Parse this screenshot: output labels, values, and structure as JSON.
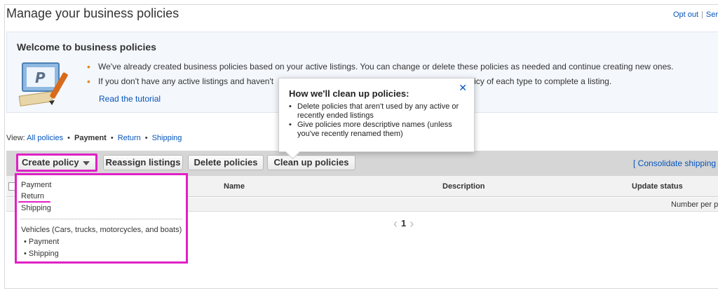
{
  "header": {
    "page_title": "Manage your business policies",
    "opt_out": "Opt out",
    "separator": "|",
    "truncated_link": "Ser"
  },
  "welcome": {
    "title": "Welcome to business policies",
    "bullets": [
      "We've already created business policies based on your active listings. You can change or delete these policies as needed and continue creating new ones.",
      "If you don't have any active listings and haven't"
    ],
    "bullet_2_tail": "policy of each type to complete a listing.",
    "tutorial_link": "Read the tutorial",
    "art_letter": "P"
  },
  "view_bar": {
    "label": "View:",
    "items": [
      {
        "label": "All policies",
        "selected": false
      },
      {
        "label": "Payment",
        "selected": true
      },
      {
        "label": "Return",
        "selected": false
      },
      {
        "label": "Shipping",
        "selected": false
      }
    ]
  },
  "toolbar": {
    "create_policy": "Create policy",
    "reassign": "Reassign listings",
    "delete": "Delete policies",
    "cleanup": "Clean up policies",
    "consolidate": "[ Consolidate shipping"
  },
  "table": {
    "columns": [
      "Name",
      "Description",
      "Update status"
    ],
    "sub_label": "Number per p"
  },
  "dropdown": {
    "items": [
      "Payment",
      "Return",
      "Shipping"
    ],
    "vehicles_label": "Vehicles (Cars, trucks, motorcycles, and boats)",
    "vehicle_items": [
      "Payment",
      "Shipping"
    ]
  },
  "pagination": {
    "current_page": "1",
    "prev": "‹",
    "next": "›"
  },
  "tooltip": {
    "title": "How we'll clean up policies:",
    "close": "✕",
    "items": [
      "Delete policies that aren't used by any active or recently ended listings",
      "Give policies more descriptive names (unless you've recently renamed them)"
    ]
  },
  "colors": {
    "link": "#0654ba",
    "highlight": "#e020c6",
    "bullet": "#e08a1e",
    "toolbar_bg": "#d6d6d6"
  }
}
